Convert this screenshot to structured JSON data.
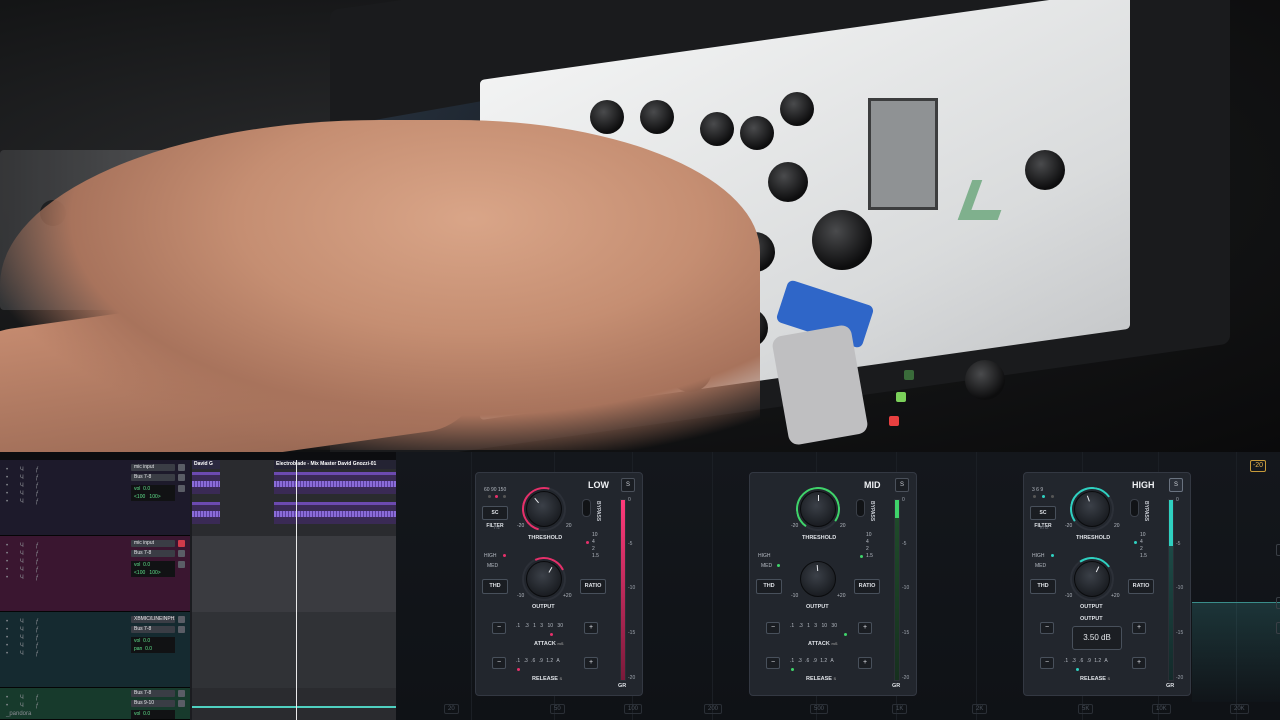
{
  "daw": {
    "tracks": [
      {
        "input": "mic input",
        "bus": "Bus 7-8",
        "vol": "vol  0.0",
        "pan": "<100   100>"
      },
      {
        "input": "mic input",
        "bus": "Bus 7-8",
        "vol": "vol  0.0",
        "pan": "<100   100>"
      },
      {
        "input": "XBMIC/LINEINPH1",
        "bus": "Bus 7-8",
        "vol": "vol  0.0",
        "pan": "pan  0.0"
      },
      {
        "input": "Bus 7-8",
        "bus": "Bus 9-10",
        "vol": "vol  0.0",
        "pan": ""
      }
    ],
    "clip_title_1": "David G",
    "clip_title_2": "Electroblade - Mix Master David Gnozzi-01",
    "track_name_bottom": "_pandora"
  },
  "plugin": {
    "badge": "-20",
    "freq_labels": [
      "20",
      "50",
      "100",
      "200",
      "500",
      "1K",
      "2K",
      "5K",
      "10K",
      "20K"
    ],
    "bands": [
      {
        "name": "LOW",
        "s": "S",
        "bypass": "BYPASS",
        "scf_values": [
          "60",
          "90",
          "150"
        ],
        "scf_label": "SC FILTER",
        "scf_unit": "Hz",
        "threshold": "THRESHOLD",
        "thr_min": "-20",
        "thr_max": "20",
        "high": "HIGH",
        "med": "MED",
        "ratio_values": [
          "10",
          "4",
          "2",
          "1.5"
        ],
        "thd": "THD",
        "ratio": "RATIO",
        "output": "OUTPUT",
        "out_min": "-10",
        "out_max": "+20",
        "attack": "ATTACK",
        "attack_unit": "mS",
        "attack_values": [
          ".1",
          ".3",
          "1",
          "3",
          "10",
          "30"
        ],
        "release": "RELEASE",
        "release_unit": "S",
        "release_values": [
          ".1",
          ".3",
          ".6",
          ".9",
          "1.2",
          "A"
        ],
        "minus": "−",
        "plus": "+",
        "meter_scale": [
          "0",
          "-5",
          "-10",
          "-15",
          "-20"
        ],
        "gr": "GR",
        "accent": "#e5306a"
      },
      {
        "name": "MID",
        "s": "S",
        "bypass": "BYPASS",
        "threshold": "THRESHOLD",
        "thr_min": "-20",
        "thr_max": "20",
        "high": "HIGH",
        "med": "MED",
        "ratio_values": [
          "10",
          "4",
          "2",
          "1.5"
        ],
        "thd": "THD",
        "ratio": "RATIO",
        "output": "OUTPUT",
        "out_min": "-10",
        "out_max": "+20",
        "attack": "ATTACK",
        "attack_unit": "mS",
        "attack_values": [
          ".1",
          ".3",
          "1",
          "3",
          "10",
          "30"
        ],
        "release": "RELEASE",
        "release_unit": "S",
        "release_values": [
          ".1",
          ".3",
          ".6",
          ".9",
          "1.2",
          "A"
        ],
        "minus": "−",
        "plus": "+",
        "meter_scale": [
          "0",
          "-5",
          "-10",
          "-15",
          "-20"
        ],
        "gr": "GR",
        "accent": "#3fd36a"
      },
      {
        "name": "HIGH",
        "s": "S",
        "bypass": "BYPASS",
        "scf_values": [
          "3",
          "6",
          "9"
        ],
        "scf_label": "SC FILTER",
        "scf_unit": "kHz",
        "threshold": "THRESHOLD",
        "thr_min": "-20",
        "thr_max": "20",
        "high": "HIGH",
        "med": "MED",
        "ratio_values": [
          "10",
          "4",
          "2",
          "1.5"
        ],
        "thd": "THD",
        "ratio": "RATIO",
        "output": "OUTPUT",
        "out_min": "-10",
        "out_max": "+20",
        "tooltip_label": "OUTPUT",
        "tooltip_value": "3.50 dB",
        "release": "RELEASE",
        "release_unit": "S",
        "release_values": [
          ".1",
          ".3",
          ".6",
          ".9",
          "1.2",
          "A"
        ],
        "minus": "−",
        "plus": "+",
        "meter_scale": [
          "0",
          "-5",
          "-10",
          "-15",
          "-20"
        ],
        "gr": "GR",
        "accent": "#2fd0c0"
      }
    ]
  }
}
